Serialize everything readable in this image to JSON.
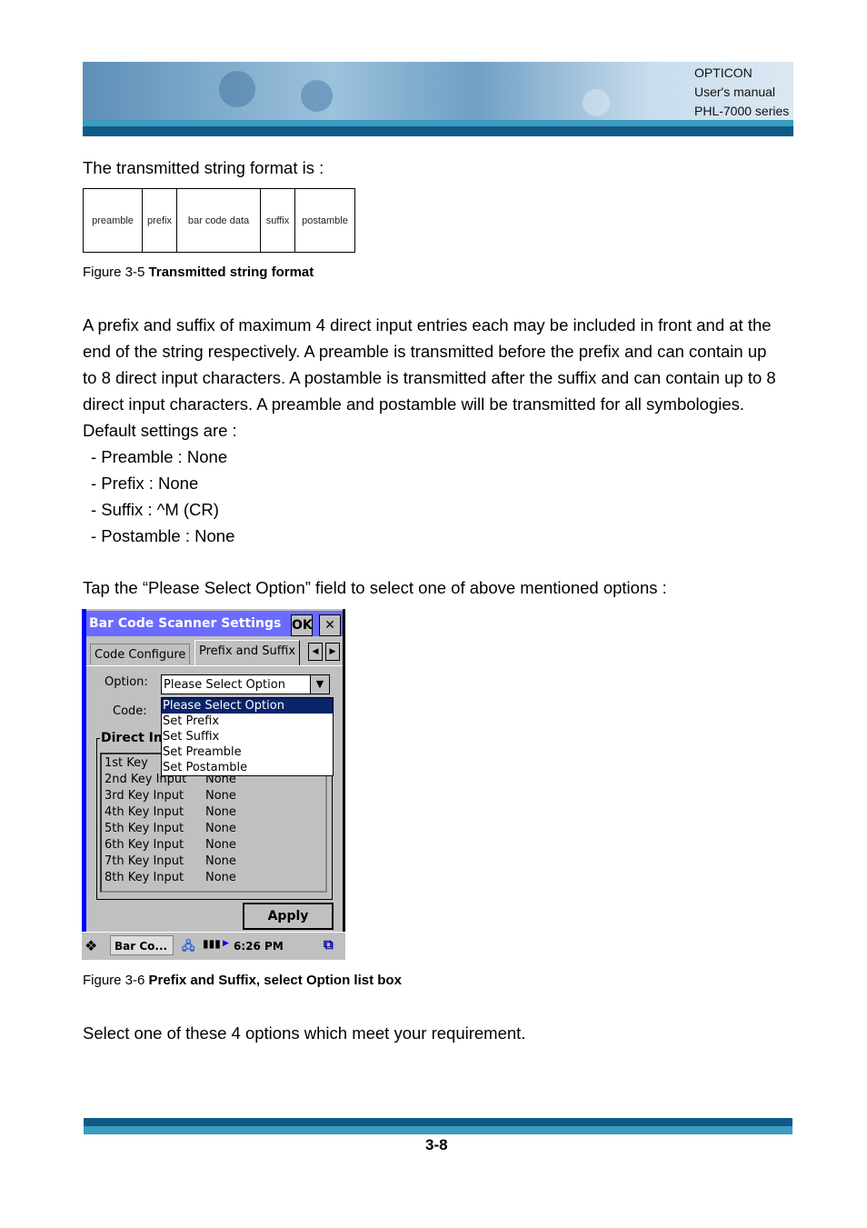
{
  "header": {
    "company": "OPTICON",
    "doc": "User's manual",
    "series": "PHL-7000 series"
  },
  "intro": "The transmitted string format is :",
  "format_cells": [
    "preamble",
    "prefix",
    "bar code data",
    "suffix",
    "postamble"
  ],
  "fig1": {
    "num": "Figure 3-5 ",
    "title": "Transmitted string format"
  },
  "para": [
    "A prefix and suffix of maximum 4 direct input entries each may be included in front and at the",
    "end of the string respectively. A preamble is transmitted before the prefix and can contain up",
    "to 8 direct input characters. A postamble is transmitted after the suffix and can contain up to 8",
    "direct input characters. A preamble and postamble will be transmitted for all symbologies.",
    "Default settings are :"
  ],
  "defaults": [
    "- Preamble : None",
    "- Prefix : None",
    "- Suffix : ^M (CR)",
    "- Postamble : None"
  ],
  "tap": "Tap the “Please Select Option” field to select one of above mentioned options :",
  "screen": {
    "title": "Bar Code Scanner Settings",
    "ok": "OK",
    "close": "✕",
    "tabs": [
      "Code Configure",
      "Prefix and Suffix"
    ],
    "option_label": "Option:",
    "code_label": "Code:",
    "option_value": "Please Select Option",
    "options": [
      "Please Select Option",
      "Set Prefix",
      "Set Suffix",
      "Set Preamble",
      "Set Postamble"
    ],
    "group_label": "Direct In",
    "first_key": "1st  Key",
    "keys": [
      {
        "k": "2nd Key Input",
        "v": "None"
      },
      {
        "k": "3rd Key Input",
        "v": "None"
      },
      {
        "k": "4th Key Input",
        "v": "None"
      },
      {
        "k": "5th Key Input",
        "v": "None"
      },
      {
        "k": "6th Key Input",
        "v": "None"
      },
      {
        "k": "7th Key Input",
        "v": "None"
      },
      {
        "k": "8th Key Input",
        "v": "None"
      }
    ],
    "apply": "Apply",
    "taskbar": {
      "app": "Bar Co...",
      "time": "6:26 PM"
    }
  },
  "fig2": {
    "num": "Figure 3-6 ",
    "title": "Prefix and Suffix, select Option list box"
  },
  "closing": "Select one of these 4 options which meet your requirement.",
  "page_number": "3-8"
}
